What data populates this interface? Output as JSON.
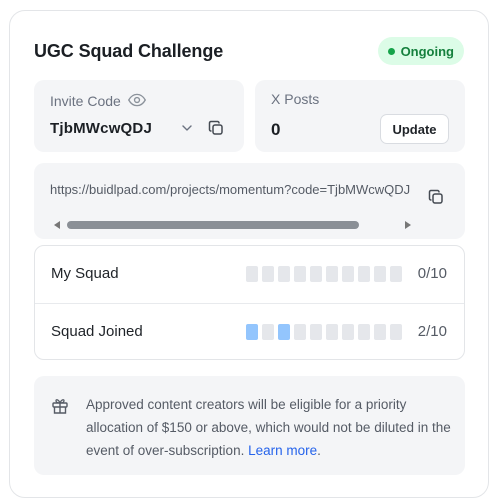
{
  "header": {
    "title": "UGC Squad Challenge",
    "status": "Ongoing"
  },
  "invite": {
    "label": "Invite Code",
    "code": "TjbMWcwQDJ"
  },
  "posts": {
    "label": "X Posts",
    "value": "0",
    "update_label": "Update"
  },
  "referral": {
    "url": "https://buidlpad.com/projects/momentum?code=TjbMWcwQDJ",
    "scroll_visible_fraction": 0.88
  },
  "squad": {
    "rows": [
      {
        "label": "My Squad",
        "filled": 0,
        "total": 10,
        "count": "0/10"
      },
      {
        "label": "Squad Joined",
        "filled": 2,
        "total": 10,
        "count": "2/10",
        "filled_positions": [
          0,
          2
        ]
      }
    ]
  },
  "note": {
    "text": "Approved content creators will be eligible for a priority allocation of $150 or above, which would not be diluted in the event of over-subscription. ",
    "link_label": "Learn more",
    "trailing": "."
  },
  "colors": {
    "status_bg": "#dcfce7",
    "status_text": "#15803d",
    "slot_filled": "#93c5fd",
    "slot_empty": "#e5e7eb",
    "link": "#2563eb"
  },
  "icons": [
    "eye-icon",
    "chevron-down-icon",
    "copy-icon",
    "gift-icon"
  ]
}
